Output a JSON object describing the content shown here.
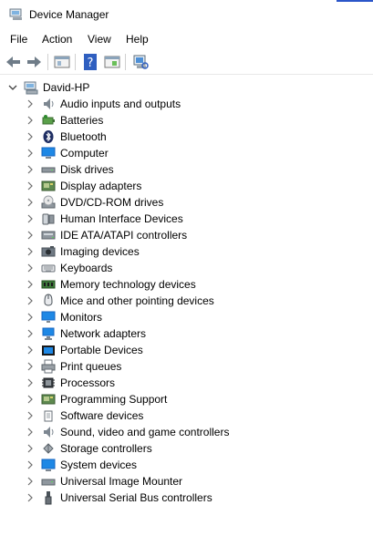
{
  "window": {
    "title": "Device Manager"
  },
  "menu": [
    "File",
    "Action",
    "View",
    "Help"
  ],
  "tree": {
    "root_label": "David-HP",
    "categories": [
      {
        "label": "Audio inputs and outputs",
        "icon": "speaker-icon"
      },
      {
        "label": "Batteries",
        "icon": "battery-icon"
      },
      {
        "label": "Bluetooth",
        "icon": "bluetooth-icon"
      },
      {
        "label": "Computer",
        "icon": "computer-icon"
      },
      {
        "label": "Disk drives",
        "icon": "disk-drive-icon"
      },
      {
        "label": "Display adapters",
        "icon": "display-adapter-icon"
      },
      {
        "label": "DVD/CD-ROM drives",
        "icon": "dvd-drive-icon"
      },
      {
        "label": "Human Interface Devices",
        "icon": "hid-icon"
      },
      {
        "label": "IDE ATA/ATAPI controllers",
        "icon": "ide-controller-icon"
      },
      {
        "label": "Imaging devices",
        "icon": "camera-icon"
      },
      {
        "label": "Keyboards",
        "icon": "keyboard-icon"
      },
      {
        "label": "Memory technology devices",
        "icon": "memory-icon"
      },
      {
        "label": "Mice and other pointing devices",
        "icon": "mouse-icon"
      },
      {
        "label": "Monitors",
        "icon": "monitor-icon"
      },
      {
        "label": "Network adapters",
        "icon": "network-icon"
      },
      {
        "label": "Portable Devices",
        "icon": "portable-device-icon"
      },
      {
        "label": "Print queues",
        "icon": "printer-icon"
      },
      {
        "label": "Processors",
        "icon": "processor-icon"
      },
      {
        "label": "Programming Support",
        "icon": "programming-icon"
      },
      {
        "label": "Software devices",
        "icon": "software-device-icon"
      },
      {
        "label": "Sound, video and game controllers",
        "icon": "sound-icon"
      },
      {
        "label": "Storage controllers",
        "icon": "storage-icon"
      },
      {
        "label": "System devices",
        "icon": "system-device-icon"
      },
      {
        "label": "Universal Image Mounter",
        "icon": "image-mounter-icon"
      },
      {
        "label": "Universal Serial Bus controllers",
        "icon": "usb-icon"
      }
    ]
  },
  "colors": {
    "accent": "#2b56c9",
    "expander": "#6e6e6e",
    "icon_blue": "#1e88e5"
  }
}
